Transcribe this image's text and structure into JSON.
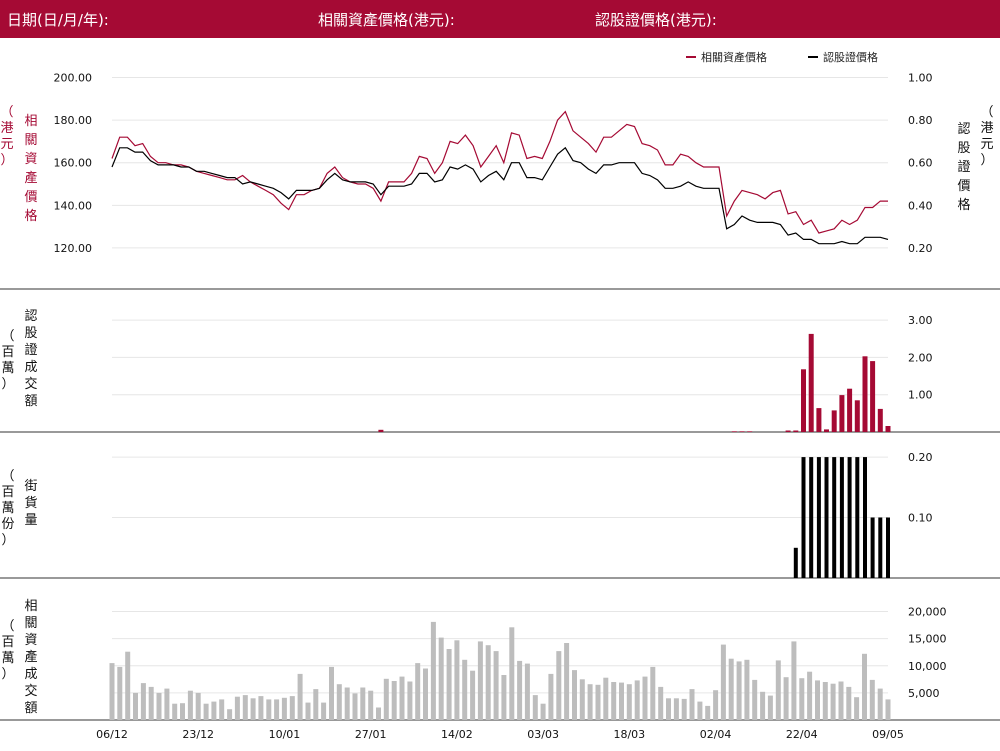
{
  "header": {
    "date_label": "日期(日/月/年):",
    "asset_price_label": "相關資產價格(港元):",
    "warrant_price_label": "認股證價格(港元):"
  },
  "colors": {
    "header_bg": "#a50a34",
    "asset": "#a50a34",
    "warrant": "#000000",
    "volume": "#bdbdbd"
  },
  "chart_data": [
    {
      "type": "line",
      "legend": [
        "相關資產價格",
        "認股證價格"
      ],
      "legend_position": "top-right",
      "left_axis": {
        "label": "相關資產價格",
        "unit": "（港元）",
        "ticks": [
          "200.00",
          "180.00",
          "160.00",
          "140.00",
          "120.00"
        ],
        "ylim": [
          104,
          212
        ]
      },
      "right_axis": {
        "label": "認股證價格",
        "unit": "（港元）",
        "ticks": [
          "1.00",
          "0.80",
          "0.60",
          "0.40",
          "0.20"
        ],
        "ylim": [
          0.04,
          1.12
        ]
      },
      "series": [
        {
          "name": "相關資產價格",
          "axis": "left",
          "values": [
            162,
            172,
            172,
            168,
            169,
            163,
            160,
            160,
            159,
            159,
            158,
            156,
            155,
            154,
            153,
            152,
            152,
            154,
            151,
            149,
            147,
            145,
            141,
            138,
            145,
            145,
            147,
            148,
            155,
            158,
            153,
            151,
            150,
            150,
            148,
            142,
            151,
            151,
            151,
            155,
            163,
            162,
            155,
            160,
            170,
            169,
            173,
            168,
            158,
            163,
            168,
            160,
            174,
            173,
            162,
            163,
            162,
            170,
            180,
            184,
            175,
            172,
            169,
            165,
            172,
            172,
            175,
            178,
            177,
            169,
            168,
            166,
            159,
            159,
            164,
            163,
            160,
            158,
            158,
            158,
            135,
            142,
            147,
            146,
            145,
            143,
            146,
            147,
            136,
            137,
            131,
            133,
            127,
            128,
            129,
            133,
            131,
            133,
            139,
            139,
            142,
            142
          ]
        },
        {
          "name": "認股證價格",
          "axis": "right",
          "values": [
            0.58,
            0.67,
            0.67,
            0.65,
            0.65,
            0.61,
            0.59,
            0.59,
            0.59,
            0.58,
            0.58,
            0.56,
            0.56,
            0.55,
            0.54,
            0.53,
            0.53,
            0.5,
            0.51,
            0.5,
            0.49,
            0.48,
            0.46,
            0.43,
            0.47,
            0.47,
            0.47,
            0.48,
            0.52,
            0.55,
            0.52,
            0.51,
            0.51,
            0.51,
            0.5,
            0.45,
            0.49,
            0.49,
            0.49,
            0.5,
            0.55,
            0.55,
            0.51,
            0.52,
            0.58,
            0.57,
            0.59,
            0.57,
            0.51,
            0.54,
            0.56,
            0.52,
            0.6,
            0.6,
            0.53,
            0.53,
            0.52,
            0.58,
            0.64,
            0.67,
            0.61,
            0.6,
            0.57,
            0.55,
            0.59,
            0.59,
            0.6,
            0.6,
            0.6,
            0.55,
            0.54,
            0.52,
            0.48,
            0.48,
            0.49,
            0.51,
            0.49,
            0.48,
            0.48,
            0.48,
            0.29,
            0.31,
            0.35,
            0.33,
            0.32,
            0.32,
            0.32,
            0.31,
            0.26,
            0.27,
            0.24,
            0.24,
            0.22,
            0.22,
            0.22,
            0.23,
            0.22,
            0.22,
            0.25,
            0.25,
            0.25,
            0.24
          ]
        }
      ]
    },
    {
      "type": "bar",
      "ylabel": "認股證成交額",
      "unit": "（百萬）",
      "ticks": [
        "3.00",
        "2.00",
        "1.00"
      ],
      "ylim": [
        0,
        3.27
      ],
      "values": [
        0,
        0,
        0,
        0,
        0,
        0,
        0,
        0,
        0,
        0,
        0,
        0,
        0,
        0,
        0,
        0,
        0,
        0,
        0,
        0,
        0,
        0,
        0,
        0,
        0,
        0,
        0,
        0,
        0,
        0,
        0,
        0,
        0,
        0,
        0,
        0.06,
        0,
        0,
        0,
        0,
        0,
        0,
        0,
        0,
        0,
        0,
        0,
        0,
        0,
        0,
        0,
        0,
        0,
        0,
        0,
        0,
        0,
        0,
        0,
        0,
        0,
        0,
        0,
        0,
        0,
        0,
        0,
        0,
        0,
        0,
        0,
        0,
        0,
        0,
        0,
        0,
        0,
        0,
        0,
        0,
        0,
        0.02,
        0.02,
        0.02,
        0,
        0,
        0,
        0,
        0.04,
        0.04,
        1.68,
        2.63,
        0.64,
        0.07,
        0.58,
        0.99,
        1.16,
        0.85,
        2.03,
        1.9,
        0.62,
        0.16
      ]
    },
    {
      "type": "bar",
      "ylabel": "街貨量",
      "unit": "（百萬份）",
      "ticks": [
        "0.20",
        "0.10"
      ],
      "ylim": [
        0,
        0.215
      ],
      "values": [
        0,
        0,
        0,
        0,
        0,
        0,
        0,
        0,
        0,
        0,
        0,
        0,
        0,
        0,
        0,
        0,
        0,
        0,
        0,
        0,
        0,
        0,
        0,
        0,
        0,
        0,
        0,
        0,
        0,
        0,
        0,
        0,
        0,
        0,
        0,
        0,
        0,
        0,
        0,
        0,
        0,
        0,
        0,
        0,
        0,
        0,
        0,
        0,
        0,
        0,
        0,
        0,
        0,
        0,
        0,
        0,
        0,
        0,
        0,
        0,
        0,
        0,
        0,
        0,
        0,
        0,
        0,
        0,
        0,
        0,
        0,
        0,
        0,
        0,
        0,
        0,
        0,
        0,
        0,
        0,
        0,
        0,
        0,
        0,
        0,
        0,
        0,
        0,
        0,
        0.05,
        0.2,
        0.2,
        0.2,
        0.2,
        0.2,
        0.2,
        0.2,
        0.2,
        0.2,
        0.1,
        0.1,
        0.1
      ]
    },
    {
      "type": "bar",
      "ylabel": "相關資產成交額",
      "unit": "（百萬）",
      "ticks": [
        "20,000",
        "15,000",
        "10,000",
        "5,000"
      ],
      "ylim": [
        0,
        22500
      ],
      "values": [
        10500,
        9800,
        12600,
        5000,
        6800,
        6100,
        5000,
        5800,
        3000,
        3100,
        5400,
        5000,
        3000,
        3400,
        3800,
        2000,
        4300,
        4600,
        4000,
        4400,
        3800,
        3800,
        4100,
        4400,
        8500,
        3200,
        5700,
        3200,
        9800,
        6600,
        6000,
        4900,
        6000,
        5400,
        2300,
        7600,
        7200,
        8000,
        7100,
        10500,
        9500,
        18100,
        15200,
        13100,
        14700,
        11100,
        9100,
        14500,
        13800,
        12700,
        8300,
        17100,
        10900,
        10400,
        4600,
        3000,
        8500,
        12700,
        14200,
        9200,
        7500,
        6600,
        6500,
        7800,
        7000,
        6900,
        6600,
        7300,
        8000,
        9800,
        6100,
        4000,
        4000,
        3900,
        5700,
        3400,
        2600,
        5500,
        13900,
        11300,
        10800,
        11100,
        7400,
        5200,
        4500,
        11000,
        7900,
        14500,
        7700,
        8900,
        7300,
        7000,
        6700,
        7100,
        6100,
        4200,
        12200,
        7400,
        5800,
        3800
      ]
    }
  ],
  "x_axis": {
    "ticks": [
      "06/12",
      "23/12",
      "10/01",
      "27/01",
      "14/02",
      "03/03",
      "18/03",
      "02/04",
      "22/04",
      "09/05"
    ]
  }
}
